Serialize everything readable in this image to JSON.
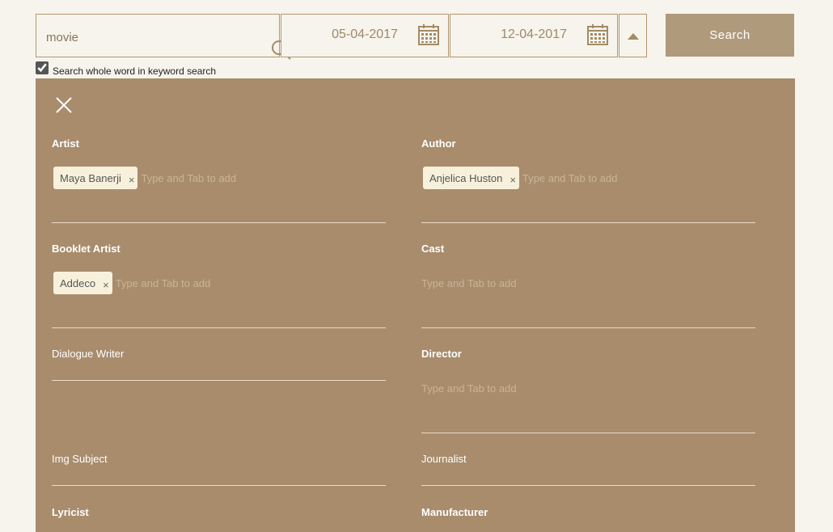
{
  "search": {
    "value": "movie"
  },
  "dates": {
    "from": "05-04-2017",
    "to": "12-04-2017"
  },
  "search_button": "Search",
  "whole_word": {
    "label": "Search whole word in keyword search",
    "checked": true
  },
  "placeholder": "Type and Tab to add",
  "fields": {
    "artist": {
      "label": "Artist",
      "tags": [
        "Maya Banerji"
      ]
    },
    "author": {
      "label": "Author",
      "tags": [
        "Anjelica Huston"
      ]
    },
    "booklet_artist": {
      "label": "Booklet Artist",
      "tags": [
        "Addeco"
      ]
    },
    "cast": {
      "label": "Cast",
      "tags": []
    },
    "dialogue_writer": {
      "label": "Dialogue Writer"
    },
    "director": {
      "label": "Director",
      "tags": []
    },
    "img_subject": {
      "label": "Img Subject"
    },
    "journalist": {
      "label": "Journalist"
    },
    "lyricist": {
      "label": "Lyricist"
    },
    "manufacturer": {
      "label": "Manufacturer"
    }
  }
}
